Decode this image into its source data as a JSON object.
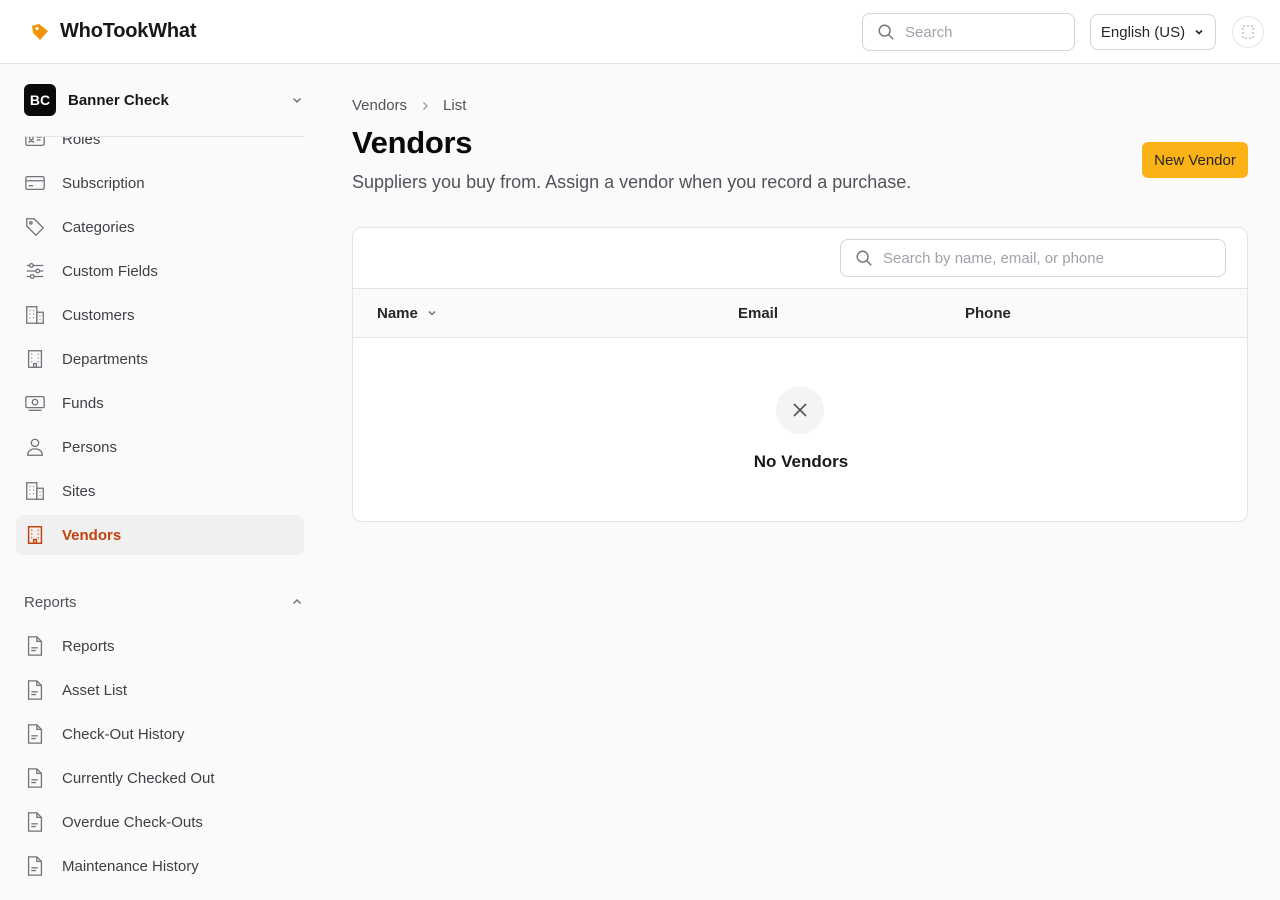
{
  "app": {
    "name": "WhoTookWhat"
  },
  "topbar": {
    "search_placeholder": "Search",
    "language": "English (US)"
  },
  "org": {
    "initials": "BC",
    "name": "Banner Check"
  },
  "sidebar": {
    "items": [
      {
        "label": "Roles",
        "icon": "id-card-icon"
      },
      {
        "label": "Subscription",
        "icon": "credit-card-icon"
      },
      {
        "label": "Categories",
        "icon": "tag-icon"
      },
      {
        "label": "Custom Fields",
        "icon": "sliders-icon"
      },
      {
        "label": "Customers",
        "icon": "building-icon"
      },
      {
        "label": "Departments",
        "icon": "office-building-icon"
      },
      {
        "label": "Funds",
        "icon": "banknote-icon"
      },
      {
        "label": "Persons",
        "icon": "user-icon"
      },
      {
        "label": "Sites",
        "icon": "building-icon"
      },
      {
        "label": "Vendors",
        "icon": "office-building-icon",
        "active": true
      }
    ],
    "reports_section": {
      "title": "Reports",
      "expanded": true
    },
    "reports": [
      {
        "label": "Reports",
        "icon": "document-icon"
      },
      {
        "label": "Asset List",
        "icon": "document-icon"
      },
      {
        "label": "Check-Out History",
        "icon": "document-icon"
      },
      {
        "label": "Currently Checked Out",
        "icon": "document-icon"
      },
      {
        "label": "Overdue Check-Outs",
        "icon": "document-icon"
      },
      {
        "label": "Maintenance History",
        "icon": "document-icon"
      }
    ]
  },
  "breadcrumb": {
    "parent": "Vendors",
    "current": "List"
  },
  "page": {
    "title": "Vendors",
    "subtitle": "Suppliers you buy from. Assign a vendor when you record a purchase.",
    "new_button": "New Vendor"
  },
  "table": {
    "search_placeholder": "Search by name, email, or phone",
    "columns": [
      "Name",
      "Email",
      "Phone"
    ],
    "sort_column": "Name",
    "rows": [],
    "empty_text": "No Vendors"
  },
  "colors": {
    "accent": "#fbb216",
    "active_nav": "#c2410c",
    "brand_icon": "#f59e0b"
  }
}
